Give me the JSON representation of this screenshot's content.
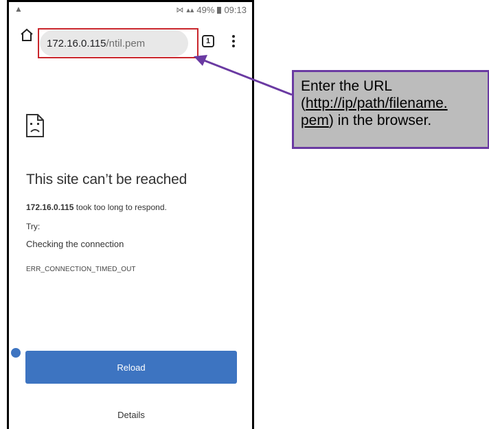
{
  "status_bar": {
    "battery": "49%",
    "time": "09:13"
  },
  "toolbar": {
    "url_host": "172.16.0.115",
    "url_path": "/ntil.pem",
    "tab_count": "1"
  },
  "error": {
    "title": "This site can’t be reached",
    "host": "172.16.0.115",
    "message": " took too long to respond.",
    "try_label": "Try:",
    "suggestion": "Checking the connection",
    "code": "ERR_CONNECTION_TIMED_OUT"
  },
  "buttons": {
    "reload": "Reload",
    "details": "Details"
  },
  "callout": {
    "line1": "Enter the URL",
    "paren_open": "(",
    "link_part1": "http://ip/path/filename.",
    "link_part2": "pem",
    "trailing": ") in the browser."
  },
  "colors": {
    "highlight": "#c9252b",
    "callout_border": "#6a3aa2",
    "callout_bg": "#bcbcbc",
    "button_blue": "#3d74c1"
  },
  "icons": [
    "warning-triangle-icon",
    "signal-icon",
    "battery-icon",
    "home-icon",
    "tabs-icon",
    "more-vert-icon",
    "sad-page-icon"
  ]
}
